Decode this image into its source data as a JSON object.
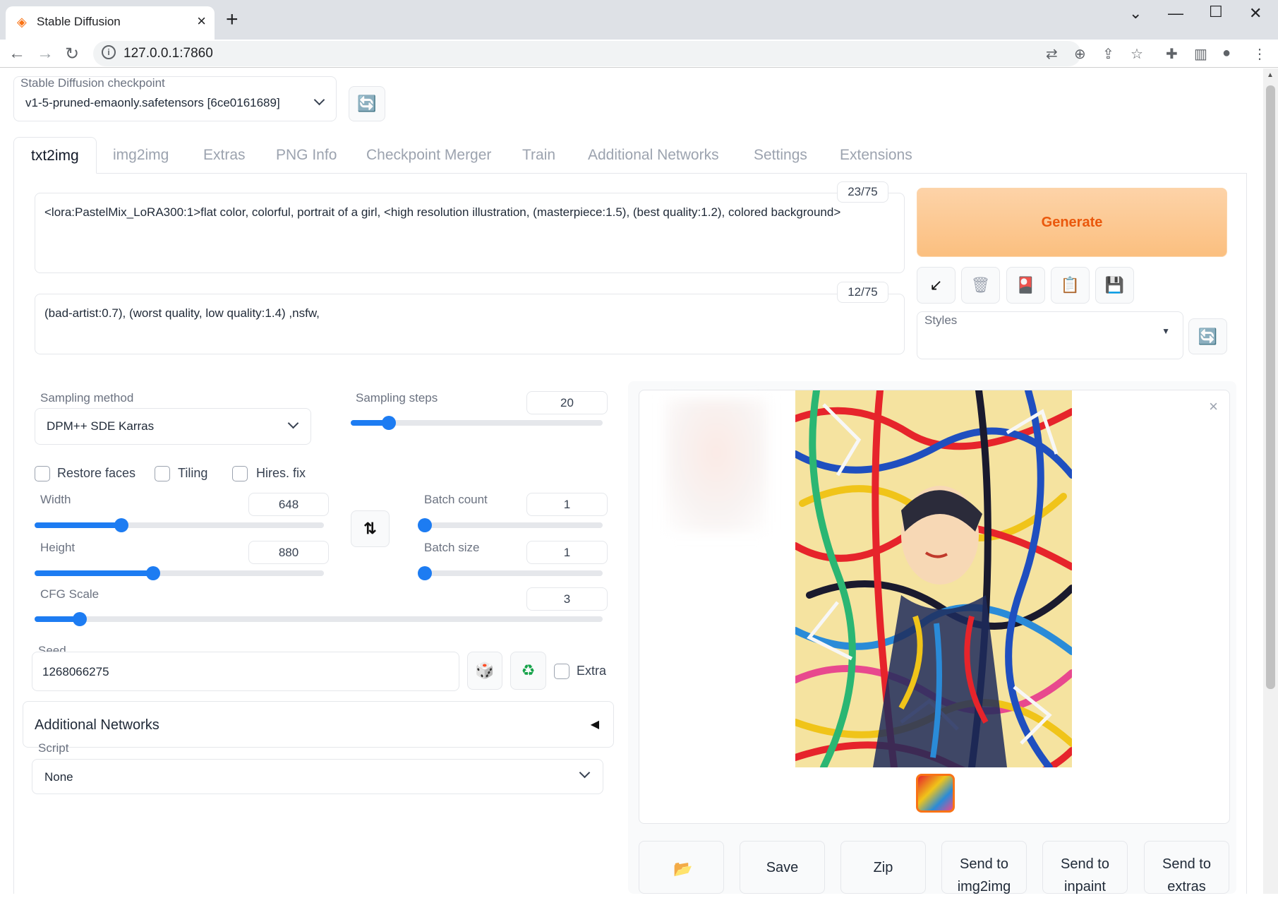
{
  "browser": {
    "tab_title": "Stable Diffusion",
    "url": "127.0.0.1:7860"
  },
  "checkpoint": {
    "label": "Stable Diffusion checkpoint",
    "value": "v1-5-pruned-emaonly.safetensors [6ce0161689]"
  },
  "tabs": [
    "txt2img",
    "img2img",
    "Extras",
    "PNG Info",
    "Checkpoint Merger",
    "Train",
    "Additional Networks",
    "Settings",
    "Extensions"
  ],
  "prompt": {
    "text": "<lora:PastelMix_LoRA300:1>flat color, colorful, portrait of a girl, <high resolution illustration, (masterpiece:1.5), (best quality:1.2), colored background>",
    "counter": "23/75"
  },
  "negative_prompt": {
    "text": "(bad-artist:0.7), (worst quality, low quality:1.4) ,nsfw,",
    "counter": "12/75"
  },
  "generate_label": "Generate",
  "styles_label": "Styles",
  "sampling": {
    "method_label": "Sampling method",
    "method_value": "DPM++ SDE Karras",
    "steps_label": "Sampling steps",
    "steps_value": "20",
    "steps_fraction": 0.15
  },
  "checkboxes": {
    "restore_faces": "Restore faces",
    "tiling": "Tiling",
    "hires_fix": "Hires. fix"
  },
  "width": {
    "label": "Width",
    "value": "648",
    "fraction": 0.3
  },
  "height": {
    "label": "Height",
    "value": "880",
    "fraction": 0.41
  },
  "batch_count": {
    "label": "Batch count",
    "value": "1",
    "fraction": 0.0
  },
  "batch_size": {
    "label": "Batch size",
    "value": "1",
    "fraction": 0.0
  },
  "cfg": {
    "label": "CFG Scale",
    "value": "3",
    "fraction": 0.08
  },
  "seed": {
    "label": "Seed",
    "value": "1268066275",
    "extra_label": "Extra"
  },
  "additional_networks": {
    "title": "Additional Networks",
    "toggle": "◀"
  },
  "script": {
    "label": "Script",
    "value": "None"
  },
  "output_buttons": {
    "save": "Save",
    "zip": "Zip",
    "send_img2img": "Send to img2img",
    "send_inpaint": "Send to inpaint",
    "send_extras": "Send to extras"
  },
  "colors": {
    "accent": "#1d7cf2",
    "generate_bg": "#fbbf7f",
    "generate_text": "#ea580c"
  }
}
